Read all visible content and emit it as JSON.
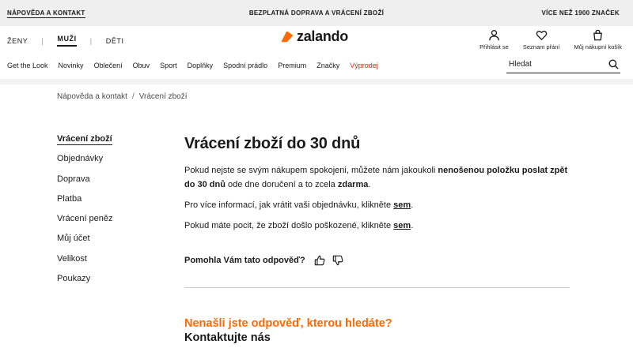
{
  "topbar": {
    "help_link": "NÁPOVĚDA A KONTAKT",
    "promo": "BEZPLATNÁ DOPRAVA A VRÁCENÍ ZBOŽÍ",
    "brands": "VÍCE NEŽ 1900 ZNAČEK"
  },
  "header": {
    "genders": [
      "ŽENY",
      "MUŽI",
      "DĚTI"
    ],
    "active_gender": "MUŽI",
    "logo": "zalando",
    "brand_color": "#ff6900",
    "user_actions": {
      "login": "Přihlásit se",
      "wishlist": "Seznam přání",
      "cart": "Můj nákupní košík"
    },
    "categories": [
      "Get the Look",
      "Novinky",
      "Oblečení",
      "Obuv",
      "Sport",
      "Doplňky",
      "Spodní prádlo",
      "Premium",
      "Značky",
      "Výprodej"
    ],
    "sale_color": "#e2211c",
    "search_placeholder": "Hledat"
  },
  "breadcrumb": [
    "Nápověda a kontakt",
    "Vrácení zboží"
  ],
  "sidenav": {
    "items": [
      "Vrácení zboží",
      "Objednávky",
      "Doprava",
      "Platba",
      "Vrácení peněz",
      "Můj účet",
      "Velikost",
      "Poukazy"
    ],
    "active": "Vrácení zboží"
  },
  "main": {
    "title": "Vrácení zboží do 30 dnů",
    "p1": {
      "a": "Pokud nejste se svým nákupem spokojeni, můžete nám jakoukoli ",
      "b": "nenošenou položku poslat zpět do 30 dnů",
      "c": " ode dne doručení a to zcela ",
      "d": "zdarma",
      "e": "."
    },
    "p2": {
      "text": "Pro více informací, jak vrátit vaši objednávku, klikněte ",
      "link": "sem",
      "end": "."
    },
    "p3": {
      "text": "Pokud máte pocit, že zboží došlo poškozené, klikněte ",
      "link": "sem",
      "end": "."
    },
    "feedback_question": "Pomohla Vám tato odpověď?",
    "not_found": "Nenašli jste odpověď, kterou hledáte?",
    "contact": "Kontaktujte nás",
    "accent_color": "#ff6900"
  }
}
